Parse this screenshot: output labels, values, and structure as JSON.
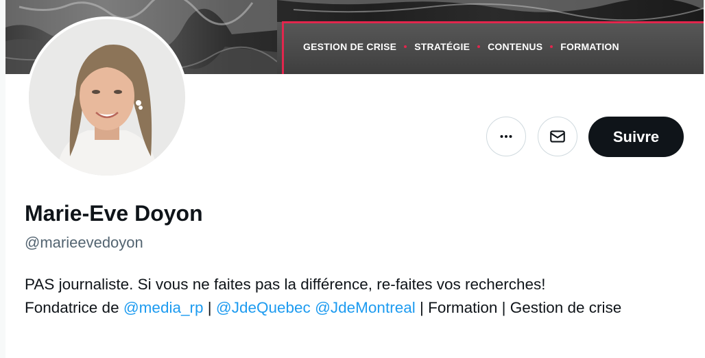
{
  "banner": {
    "nav_items": [
      {
        "label": "GESTION DE CRISE"
      },
      {
        "label": "STRATÉGIE"
      },
      {
        "label": "CONTENUS"
      },
      {
        "label": "FORMATION"
      }
    ],
    "accent_color": "#e2264d"
  },
  "profile": {
    "display_name": "Marie-Eve Doyon",
    "handle": "@marieevedoyon"
  },
  "actions": {
    "more_icon": "more-horizontal-icon",
    "message_icon": "envelope-icon",
    "follow_label": "Suivre"
  },
  "bio": {
    "line1": "PAS journaliste. Si vous ne faites pas la différence, re-faites vos recherches!",
    "prefix": "Fondatrice de ",
    "mention1": "@media_rp",
    "sep1": " | ",
    "mention2": "@JdeQuebec",
    "space": " ",
    "mention3": "@JdeMontreal",
    "suffix": " | Formation | Gestion de crise"
  },
  "colors": {
    "text": "#0f1419",
    "secondary_text": "#536471",
    "link": "#1d9bf0",
    "follow_bg": "#0f1419",
    "border": "#cfd9de"
  }
}
